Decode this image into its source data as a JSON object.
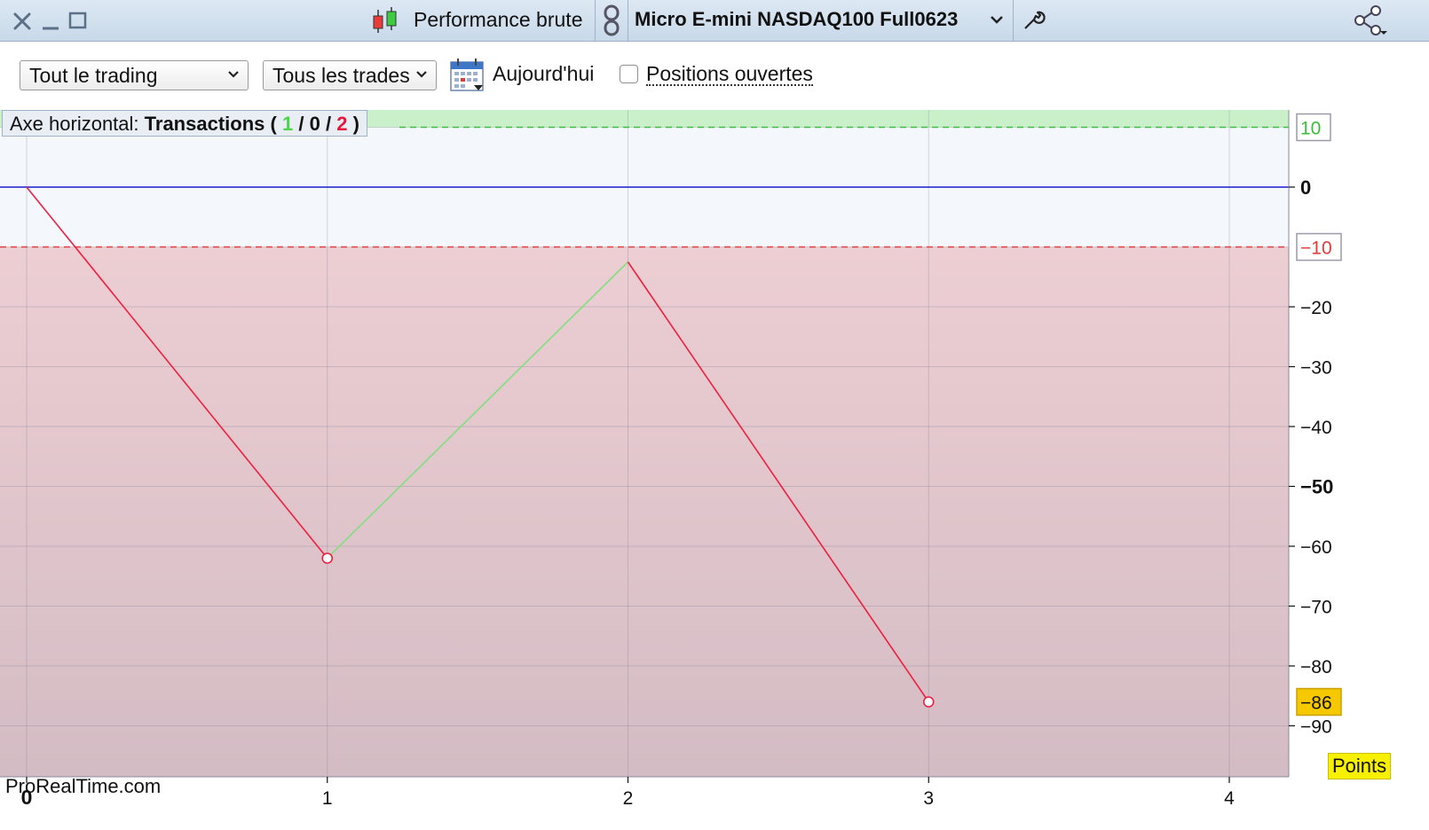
{
  "titlebar": {
    "title": "Performance brute",
    "instrument": "Micro E-mini NASDAQ100 Full0623"
  },
  "toolbar": {
    "trading_filter": "Tout le trading",
    "trades_filter": "Tous les trades",
    "date_label": "Aujourd'hui",
    "open_positions_label": "Positions ouvertes",
    "open_positions_checked": false
  },
  "axis_overlay": {
    "prefix": "Axe horizontal:",
    "mode": "Transactions",
    "open_paren": "(",
    "wins": "1",
    "sep1": "/",
    "neutral": "0",
    "sep2": "/",
    "losses": "2",
    "close_paren": ")"
  },
  "chart_data": {
    "type": "line",
    "x": [
      0,
      1,
      2,
      3
    ],
    "y": [
      0,
      -62,
      -12.5,
      -86
    ],
    "segment_colors": [
      "#ee1f3f",
      "#7fe07f",
      "#ee1f3f"
    ],
    "xlim": [
      0,
      4.2
    ],
    "ylim": [
      -98,
      12
    ],
    "x_ticks": [
      "0",
      "1",
      "2",
      "3",
      "4"
    ],
    "y_ticks": [
      "10",
      "0",
      "-10",
      "-20",
      "-30",
      "-40",
      "-50",
      "-60",
      "-70",
      "-80",
      "-86",
      "-90"
    ],
    "profit_threshold": 10,
    "loss_threshold": -10,
    "last_value": -86,
    "unit_label": "Points",
    "colors": {
      "profit_zone": "#c9f0c9",
      "loss_zone": "#d8b8c0",
      "neutral_zone": "#f4f8fc",
      "zero_line": "#1a1acc",
      "up_segment": "#7fe07f",
      "down_segment": "#ee1f3f",
      "last_badge": "#f5c800"
    }
  },
  "brand": "ProRealTime.com"
}
